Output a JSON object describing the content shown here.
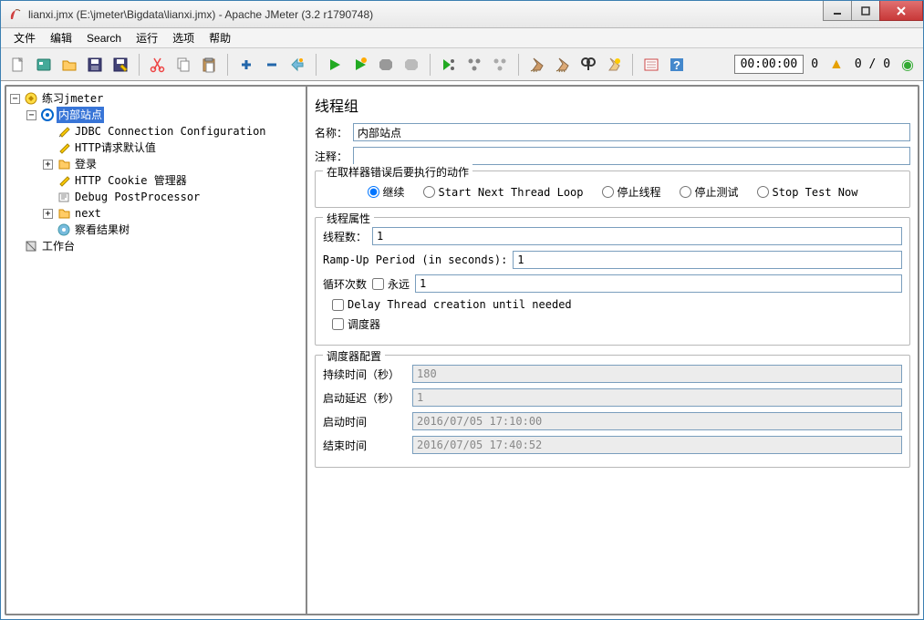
{
  "window": {
    "title": "lianxi.jmx (E:\\jmeter\\Bigdata\\lianxi.jmx) - Apache JMeter (3.2 r1790748)"
  },
  "menu": {
    "file": "文件",
    "edit": "编辑",
    "search": "Search",
    "run": "运行",
    "options": "选项",
    "help": "帮助"
  },
  "toolbar": {
    "timer": "00:00:00",
    "count0": "0",
    "slash": "0 / 0"
  },
  "tree": {
    "root": "练习jmeter",
    "sel": "内部站点",
    "i1": "JDBC Connection Configuration",
    "i2": "HTTP请求默认值",
    "i3": "登录",
    "i4": "HTTP Cookie 管理器",
    "i5": "Debug PostProcessor",
    "i6": "next",
    "i7": "察看结果树",
    "workbench": "工作台"
  },
  "form": {
    "title": "线程组",
    "name_label": "名称：",
    "name_value": "内部站点",
    "comment_label": "注释：",
    "comment_value": "",
    "onerror": {
      "legend": "在取样器错误后要执行的动作",
      "continue": "继续",
      "startnext": "Start Next Thread Loop",
      "stopthread": "停止线程",
      "stoptest": "停止测试",
      "stopnow": "Stop Test Now"
    },
    "threadprops": {
      "legend": "线程属性",
      "threads_label": "线程数：",
      "threads_value": "1",
      "rampup_label": "Ramp-Up Period (in seconds):",
      "rampup_value": "1",
      "loop_label": "循环次数",
      "forever": "永远",
      "loop_value": "1",
      "delay_create": "Delay Thread creation until needed",
      "scheduler": "调度器"
    },
    "sched": {
      "legend": "调度器配置",
      "duration_label": "持续时间（秒）",
      "duration_value": "180",
      "delay_label": "启动延迟（秒）",
      "delay_value": "1",
      "start_label": "启动时间",
      "start_value": "2016/07/05 17:10:00",
      "end_label": "结束时间",
      "end_value": "2016/07/05 17:40:52"
    }
  }
}
